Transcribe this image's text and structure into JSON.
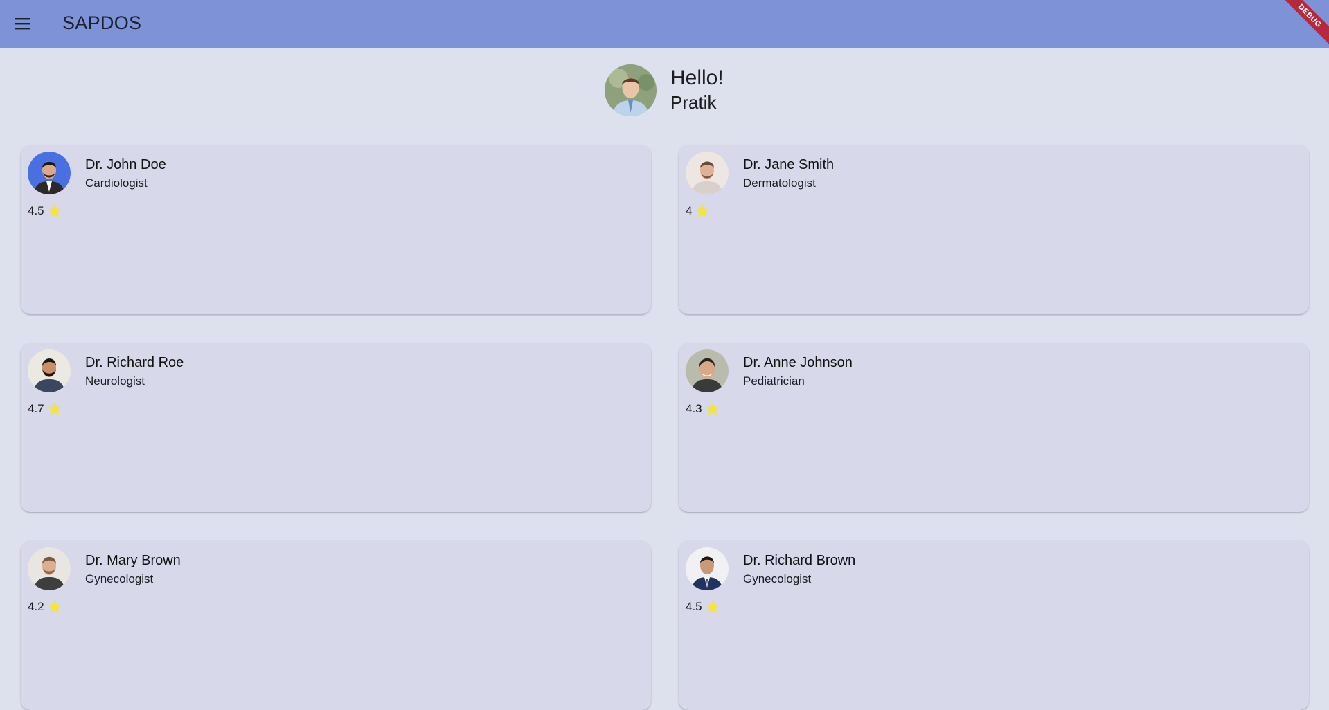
{
  "app": {
    "title": "SAPDOS",
    "debug_label": "DEBUG",
    "menu_icon": "menu-icon"
  },
  "greeting": {
    "hello": "Hello!",
    "name": "Pratik"
  },
  "doctors": [
    {
      "name": "Dr. John Doe",
      "specialty": "Cardiologist",
      "rating": "4.5",
      "avatar_bg": "#4a6fe0",
      "shirt": "#2a2a2a"
    },
    {
      "name": "Dr. Jane Smith",
      "specialty": "Dermatologist",
      "rating": "4",
      "avatar_bg": "#ede6e2",
      "shirt": "#d9d0cc"
    },
    {
      "name": "Dr. Richard Roe",
      "specialty": "Neurologist",
      "rating": "4.7",
      "avatar_bg": "#ece8e2",
      "shirt": "#3b4660"
    },
    {
      "name": "Dr. Anne Johnson",
      "specialty": "Pediatrician",
      "rating": "4.3",
      "avatar_bg": "#b9bcad",
      "shirt": "#3a3a3a"
    },
    {
      "name": "Dr. Mary Brown",
      "specialty": "Gynecologist",
      "rating": "4.2",
      "avatar_bg": "#e9e5e3",
      "shirt": "#3e3e3e"
    },
    {
      "name": "Dr. Richard Brown",
      "specialty": "Gynecologist",
      "rating": "4.5",
      "avatar_bg": "#f1f1f3",
      "shirt": "#1f3560"
    }
  ],
  "colors": {
    "appbar": "#7e93d7",
    "background": "#dde0ed",
    "card": "#d7d8e9",
    "star": "#f5e43a",
    "debug_banner": "#b5293f"
  }
}
